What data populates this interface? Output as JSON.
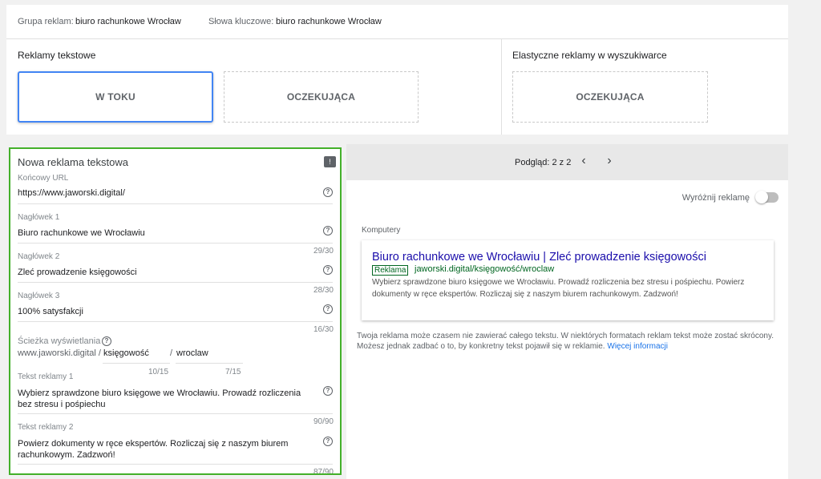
{
  "info_bar": {
    "ad_group_key": "Grupa reklam:",
    "ad_group_value": "biuro rachunkowe Wrocław",
    "keywords_key": "Słowa kluczowe:",
    "keywords_value": "biuro rachunkowe Wrocław"
  },
  "ad_types": {
    "text_ads_title": "Reklamy tekstowe",
    "text_ads_tiles": [
      "W TOKU",
      "OCZEKUJĄCA"
    ],
    "responsive_title": "Elastyczne reklamy w wyszukiwarce",
    "responsive_tiles": [
      "OCZEKUJĄCA"
    ]
  },
  "form": {
    "title": "Nowa reklama tekstowa",
    "final_url_label": "Końcowy URL",
    "final_url_value": "https://www.jaworski.digital/",
    "headline1_label": "Nagłówek 1",
    "headline1_value": "Biuro rachunkowe we Wrocławiu",
    "headline1_count": "29/30",
    "headline2_label": "Nagłówek 2",
    "headline2_value": "Zleć prowadzenie księgowości",
    "headline2_count": "28/30",
    "headline3_label": "Nagłówek 3",
    "headline3_value": "100% satysfakcji",
    "headline3_count": "16/30",
    "path_label": "Ścieżka wyświetlania",
    "path_domain": "www.jaworski.digital /",
    "path1_value": "księgowość",
    "path_sep": "/",
    "path2_value": "wroclaw",
    "path1_count": "10/15",
    "path2_count": "7/15",
    "desc1_label": "Tekst reklamy 1",
    "desc1_value": "Wybierz sprawdzone biuro księgowe we Wrocławiu. Prowadź rozliczenia bez stresu i pośpiechu",
    "desc1_count": "90/90",
    "desc2_label": "Tekst reklamy 2",
    "desc2_value": "Powierz dokumenty w ręce ekspertów. Rozliczaj się z naszym biurem rachunkowym. Zadzwoń!",
    "desc2_count": "87/90"
  },
  "preview": {
    "label": "Podgląd: 2 z 2",
    "prev_arrow": "‹",
    "next_arrow": "›",
    "highlight_label": "Wyróżnij reklamę",
    "device_label": "Komputery",
    "ad_headline": "Biuro rachunkowe we Wrocławiu | Zleć prowadzenie księgowości",
    "ad_badge": "Reklama",
    "ad_url": "jaworski.digital/księgowość/wroclaw",
    "ad_desc": "Wybierz sprawdzone biuro księgowe we Wrocławiu. Prowadź rozliczenia bez stresu i pośpiechu. Powierz dokumenty w ręce ekspertów. Rozliczaj się z naszym biurem rachunkowym. Zadzwoń!",
    "note_text": "Twoja reklama może czasem nie zawierać całego tekstu. W niektórych formatach reklam tekst może zostać skrócony. Możesz jednak zadbać o to, by konkretny tekst pojawił się w reklamie.",
    "note_link": "Więcej informacji"
  }
}
